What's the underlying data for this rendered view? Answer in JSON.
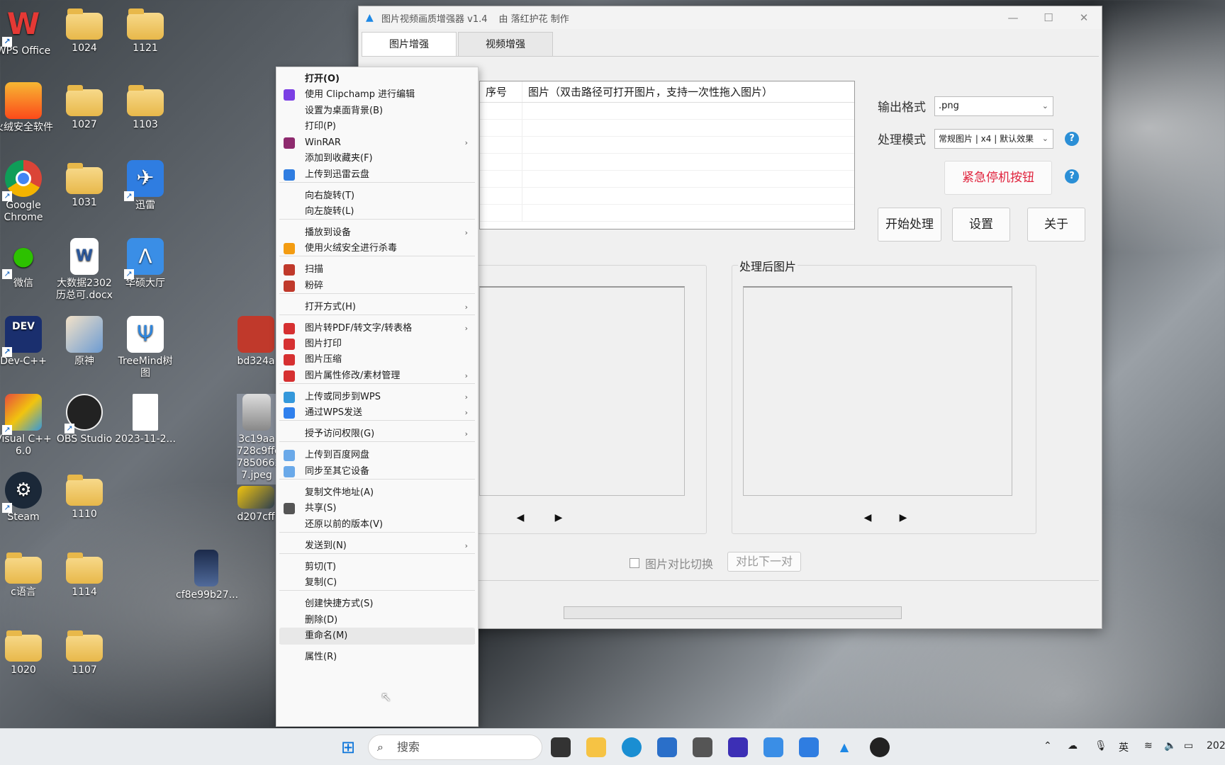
{
  "desktop": {
    "icons": [
      {
        "label": "WPS Office"
      },
      {
        "label": "1024"
      },
      {
        "label": "1121"
      },
      {
        "label": "火绒安全软件"
      },
      {
        "label": "1027"
      },
      {
        "label": "1103"
      },
      {
        "label": "Google Chrome"
      },
      {
        "label": "1031"
      },
      {
        "label": "迅雷"
      },
      {
        "label": "微信"
      },
      {
        "label": "大数据2302 历总可.docx"
      },
      {
        "label": "华硕大厅"
      },
      {
        "label": "Dev-C++"
      },
      {
        "label": "原神"
      },
      {
        "label": "TreeMind树图"
      },
      {
        "label": "bd324a"
      },
      {
        "label": "Visual C++ 6.0"
      },
      {
        "label": "OBS Studio"
      },
      {
        "label": "2023-11-2..."
      },
      {
        "label": "3c19aa 728c9ffe 7850662 7.jpeg"
      },
      {
        "label": "Steam"
      },
      {
        "label": "1110"
      },
      {
        "label": "d207cff"
      },
      {
        "label": "c语言"
      },
      {
        "label": "1114"
      },
      {
        "label": "cf8e99b27..."
      },
      {
        "label": "1020"
      },
      {
        "label": "1107"
      }
    ]
  },
  "app": {
    "title": "图片视频画质增强器 v1.4",
    "author": "由 落红护花 制作",
    "tabs": [
      {
        "label": "图片增强",
        "active": true
      },
      {
        "label": "视频增强",
        "active": false
      }
    ],
    "table": {
      "col_index": "序号",
      "col_image": "图片（双击路径可打开图片，支持一次性拖入图片）"
    },
    "output_format_label": "输出格式",
    "output_format_value": ".png",
    "mode_label": "处理模式",
    "mode_value": "常规图片 | x4 | 默认效果",
    "emergency_stop": "紧急停机按钮",
    "start": "开始处理",
    "settings": "设置",
    "about": "关于",
    "processed_title": "处理后图片",
    "compare_toggle": "图片对比切换",
    "compare_next": "对比下一对",
    "help_glyph": "?"
  },
  "context_menu": {
    "items": [
      {
        "label": "打开(O)",
        "bold": true
      },
      {
        "label": "使用 Clipchamp 进行编辑",
        "icon": "clipchamp-icon",
        "color": "#7b3fe4"
      },
      {
        "label": "设置为桌面背景(B)"
      },
      {
        "label": "打印(P)"
      },
      {
        "label": "WinRAR",
        "icon": "winrar-icon",
        "color": "#8e2a6e",
        "submenu": true
      },
      {
        "label": "添加到收藏夹(F)"
      },
      {
        "label": "上传到迅雷云盘",
        "icon": "thunder-icon",
        "color": "#2f7de1"
      },
      {
        "label": "向右旋转(T)"
      },
      {
        "label": "向左旋转(L)"
      },
      {
        "label": "播放到设备",
        "submenu": true
      },
      {
        "label": "使用火绒安全进行杀毒",
        "icon": "huorong-icon",
        "color": "#f39c12"
      },
      {
        "label": "扫描",
        "icon": "mcafee-icon",
        "color": "#c0392b"
      },
      {
        "label": "粉碎",
        "icon": "mcafee-icon",
        "color": "#c0392b"
      },
      {
        "label": "打开方式(H)",
        "submenu": true
      },
      {
        "label": "图片转PDF/转文字/转表格",
        "icon": "wps-icon",
        "color": "#d63031",
        "submenu": true
      },
      {
        "label": "图片打印",
        "icon": "wps-icon",
        "color": "#d63031"
      },
      {
        "label": "图片压缩",
        "icon": "wps-icon",
        "color": "#d63031"
      },
      {
        "label": "图片属性修改/素材管理",
        "icon": "wps-icon",
        "color": "#d63031",
        "submenu": true
      },
      {
        "label": "上传或同步到WPS",
        "icon": "cloud-icon",
        "color": "#3498db",
        "submenu": true
      },
      {
        "label": "通过WPS发送",
        "icon": "send-icon",
        "color": "#2f80ed",
        "submenu": true
      },
      {
        "label": "授予访问权限(G)",
        "submenu": true
      },
      {
        "label": "上传到百度网盘",
        "icon": "baidu-icon",
        "color": "#6aa9e9"
      },
      {
        "label": "同步至其它设备",
        "icon": "baidu-icon",
        "color": "#6aa9e9"
      },
      {
        "label": "复制文件地址(A)"
      },
      {
        "label": "共享(S)",
        "icon": "share-icon",
        "color": "#555555"
      },
      {
        "label": "还原以前的版本(V)"
      },
      {
        "label": "发送到(N)",
        "submenu": true
      },
      {
        "label": "剪切(T)"
      },
      {
        "label": "复制(C)"
      },
      {
        "label": "创建快捷方式(S)"
      },
      {
        "label": "删除(D)"
      },
      {
        "label": "重命名(M)",
        "hover": true
      },
      {
        "label": "属性(R)"
      }
    ]
  },
  "taskbar": {
    "search_placeholder": "搜索",
    "ime": "英",
    "clock": "202"
  }
}
